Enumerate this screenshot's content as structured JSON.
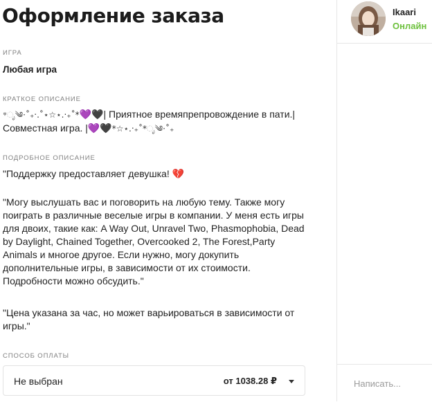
{
  "page": {
    "title": "Оформление заказа"
  },
  "game": {
    "label": "ИГРА",
    "value": "Любая игра"
  },
  "short": {
    "label": "КРАТКОЕ ОПИСАНИЕ",
    "deco1": "*ೃ༄·˚₊‧.˚⋆☆⋆.‧₊˚*",
    "heart1": "💜",
    "heart2": "🖤",
    "text1": "| Приятное времяпрепровождение в пати.|",
    "text2": "Совместная игра. |",
    "heart3": "💜",
    "heart4": "🖤",
    "deco2": "*☆⋆.‧₊˚*ೃ༄·˚₊"
  },
  "detailed": {
    "label": "ПОДРОБНОЕ ОПИСАНИЕ",
    "p1": "\"Поддержку предоставляет девушка!",
    "p1_emoji": "💔",
    "p2_lines": [
      "\"Могу выслушать вас и поговорить на любую тему. Также могу",
      "поиграть в различные веселые игры в компании. У меня есть игры",
      "для двоих, такие как: A Way Out, Unravel Two, Phasmophobia, Dead",
      "by Daylight, Chained Together, Overcooked 2, The Forest,Party",
      "Animals и многое другое. Если нужно, могу докупить",
      "дополнительные игры, в зависимости от их стоимости.",
      "Подробности можно обсудить.\""
    ],
    "p3_lines": [
      "\"Цена указана за час, но может варьироваться в зависимости от",
      "игры.\""
    ]
  },
  "payment": {
    "label": "СПОСОБ ОПЛАТЫ",
    "selected": "Не выбран",
    "price": "от 1038.28 ₽",
    "caret_icon": "caret-down-icon"
  },
  "chat": {
    "user_name": "Ikaari",
    "status": "Онлайн",
    "status_color": "#6cc03c",
    "placeholder": "Написать..."
  }
}
